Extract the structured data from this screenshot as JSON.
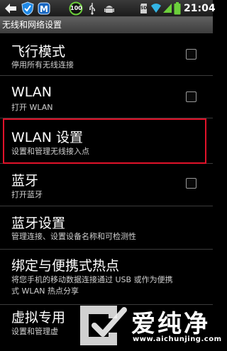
{
  "status_bar": {
    "time": "21:04",
    "sd_label": "SD",
    "battery_badge": "100",
    "icons": [
      "back-arrow-icon",
      "shield-icon",
      "maxthon-icon",
      "battery-100-icon",
      "usb-icon",
      "android-debug-icon",
      "sd-card-icon",
      "wifi-icon",
      "signal-icon",
      "battery-icon"
    ]
  },
  "title": "无线和网络设置",
  "items": [
    {
      "title": "飞行模式",
      "summary": "停用所有无线连接",
      "checkbox": true,
      "checked": false
    },
    {
      "title": "WLAN",
      "summary": "打开 WLAN",
      "checkbox": true,
      "checked": false
    },
    {
      "title": "WLAN 设置",
      "summary": "设置和管理无线接入点",
      "checkbox": false,
      "highlighted": true
    },
    {
      "title": "蓝牙",
      "summary": "打开蓝牙",
      "checkbox": true,
      "checked": false
    },
    {
      "title": "蓝牙设置",
      "summary": "管理连接、设置设备名称和可检测性",
      "checkbox": false
    },
    {
      "title": "绑定与便携式热点",
      "summary_line1": "将您手机的移动数据连接通过 USB 或作为便携",
      "summary_line2": "式 WLAN 热点分享",
      "checkbox": false
    },
    {
      "title": "虚拟专用",
      "summary": "设置和管理虚",
      "checkbox": false
    }
  ],
  "watermark": {
    "text": "爱纯净",
    "url": "www.aichunjing.com"
  },
  "colors": {
    "highlight": "#e1122a",
    "background": "#000000",
    "title_bar": "#4a4a4a",
    "wifi": "#33b5e5"
  }
}
